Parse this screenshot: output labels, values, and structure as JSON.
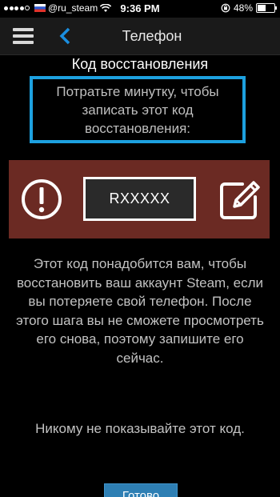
{
  "status_bar": {
    "carrier": "@ru_steam",
    "time": "9:36 PM",
    "battery_percent": "48%",
    "battery_level": 0.48,
    "signal_bars_filled": 4,
    "signal_bars_total": 5
  },
  "nav": {
    "title": "Телефон"
  },
  "content": {
    "heading": "Код восстановления",
    "instruction": "Потратьте минутку, чтобы записать этот код восстановления:",
    "recovery_code": "RXXXXX",
    "info": "Этот код понадобится вам, чтобы восстановить ваш аккаунт Steam, если вы потеряете свой телефон. После этого шага вы не сможете просмотреть его снова, поэтому запишите его сейчас.",
    "warning": "Никому не показывайте этот код.",
    "finish_button_label": "Готово"
  },
  "colors": {
    "accent_blue": "#1da1e0",
    "panel_red": "#6b2a23",
    "button_blue": "#2e7fb4"
  }
}
